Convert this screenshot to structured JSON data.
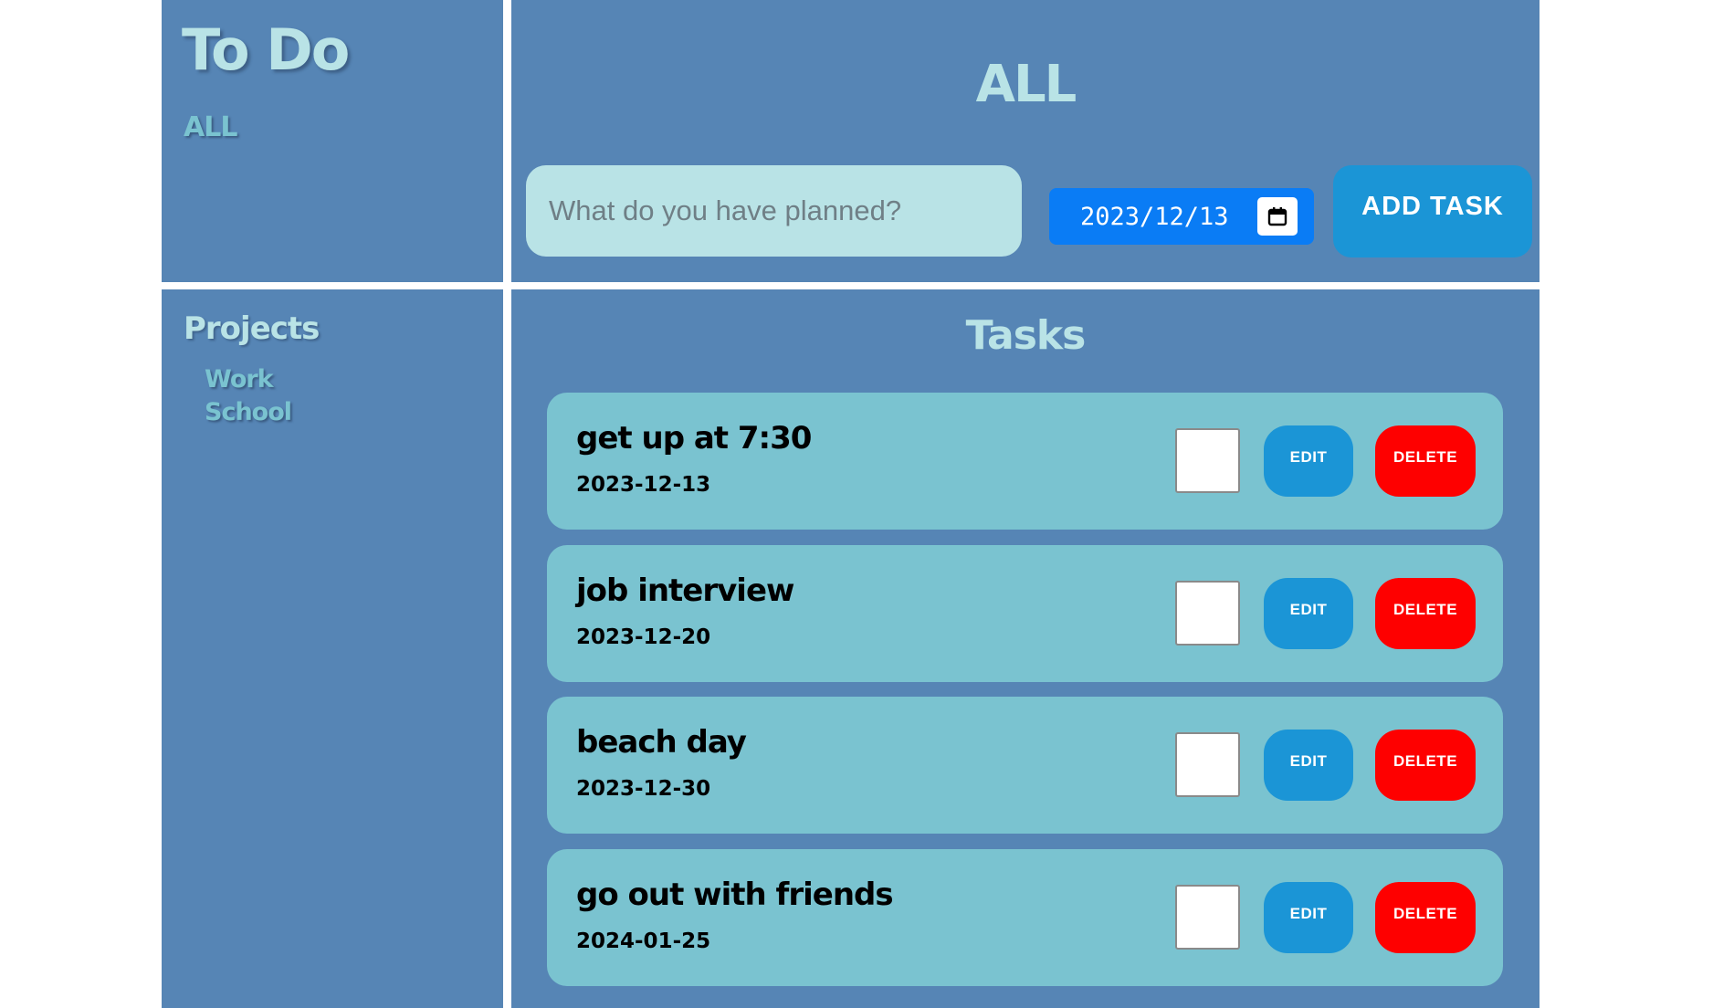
{
  "brand": {
    "title": "To Do",
    "filter_all": "ALL"
  },
  "header": {
    "title": "ALL",
    "task_input_placeholder": "What do you have planned?",
    "date_value": "2023/12/13",
    "add_button_label": "ADD TASK"
  },
  "projects": {
    "heading": "Projects",
    "items": [
      "Work",
      "School"
    ]
  },
  "tasks": {
    "heading": "Tasks",
    "edit_label": "EDIT",
    "delete_label": "DELETE",
    "items": [
      {
        "name": "get up at 7:30",
        "date": "2023-12-13",
        "completed": false
      },
      {
        "name": "job interview",
        "date": "2023-12-20",
        "completed": false
      },
      {
        "name": "beach day",
        "date": "2023-12-30",
        "completed": false
      },
      {
        "name": "go out with friends",
        "date": "2024-01-25",
        "completed": false
      }
    ]
  },
  "colors": {
    "panel_bg": "#5685b5",
    "title_text": "#b9e3e6",
    "accent_text": "#7ac3d0",
    "card_bg": "#7ac3d0",
    "date_input_bg": "#0a7cf5",
    "edit_button": "#1b95d6",
    "delete_button": "#fe0000"
  },
  "icons": {
    "calendar": "calendar-icon"
  }
}
